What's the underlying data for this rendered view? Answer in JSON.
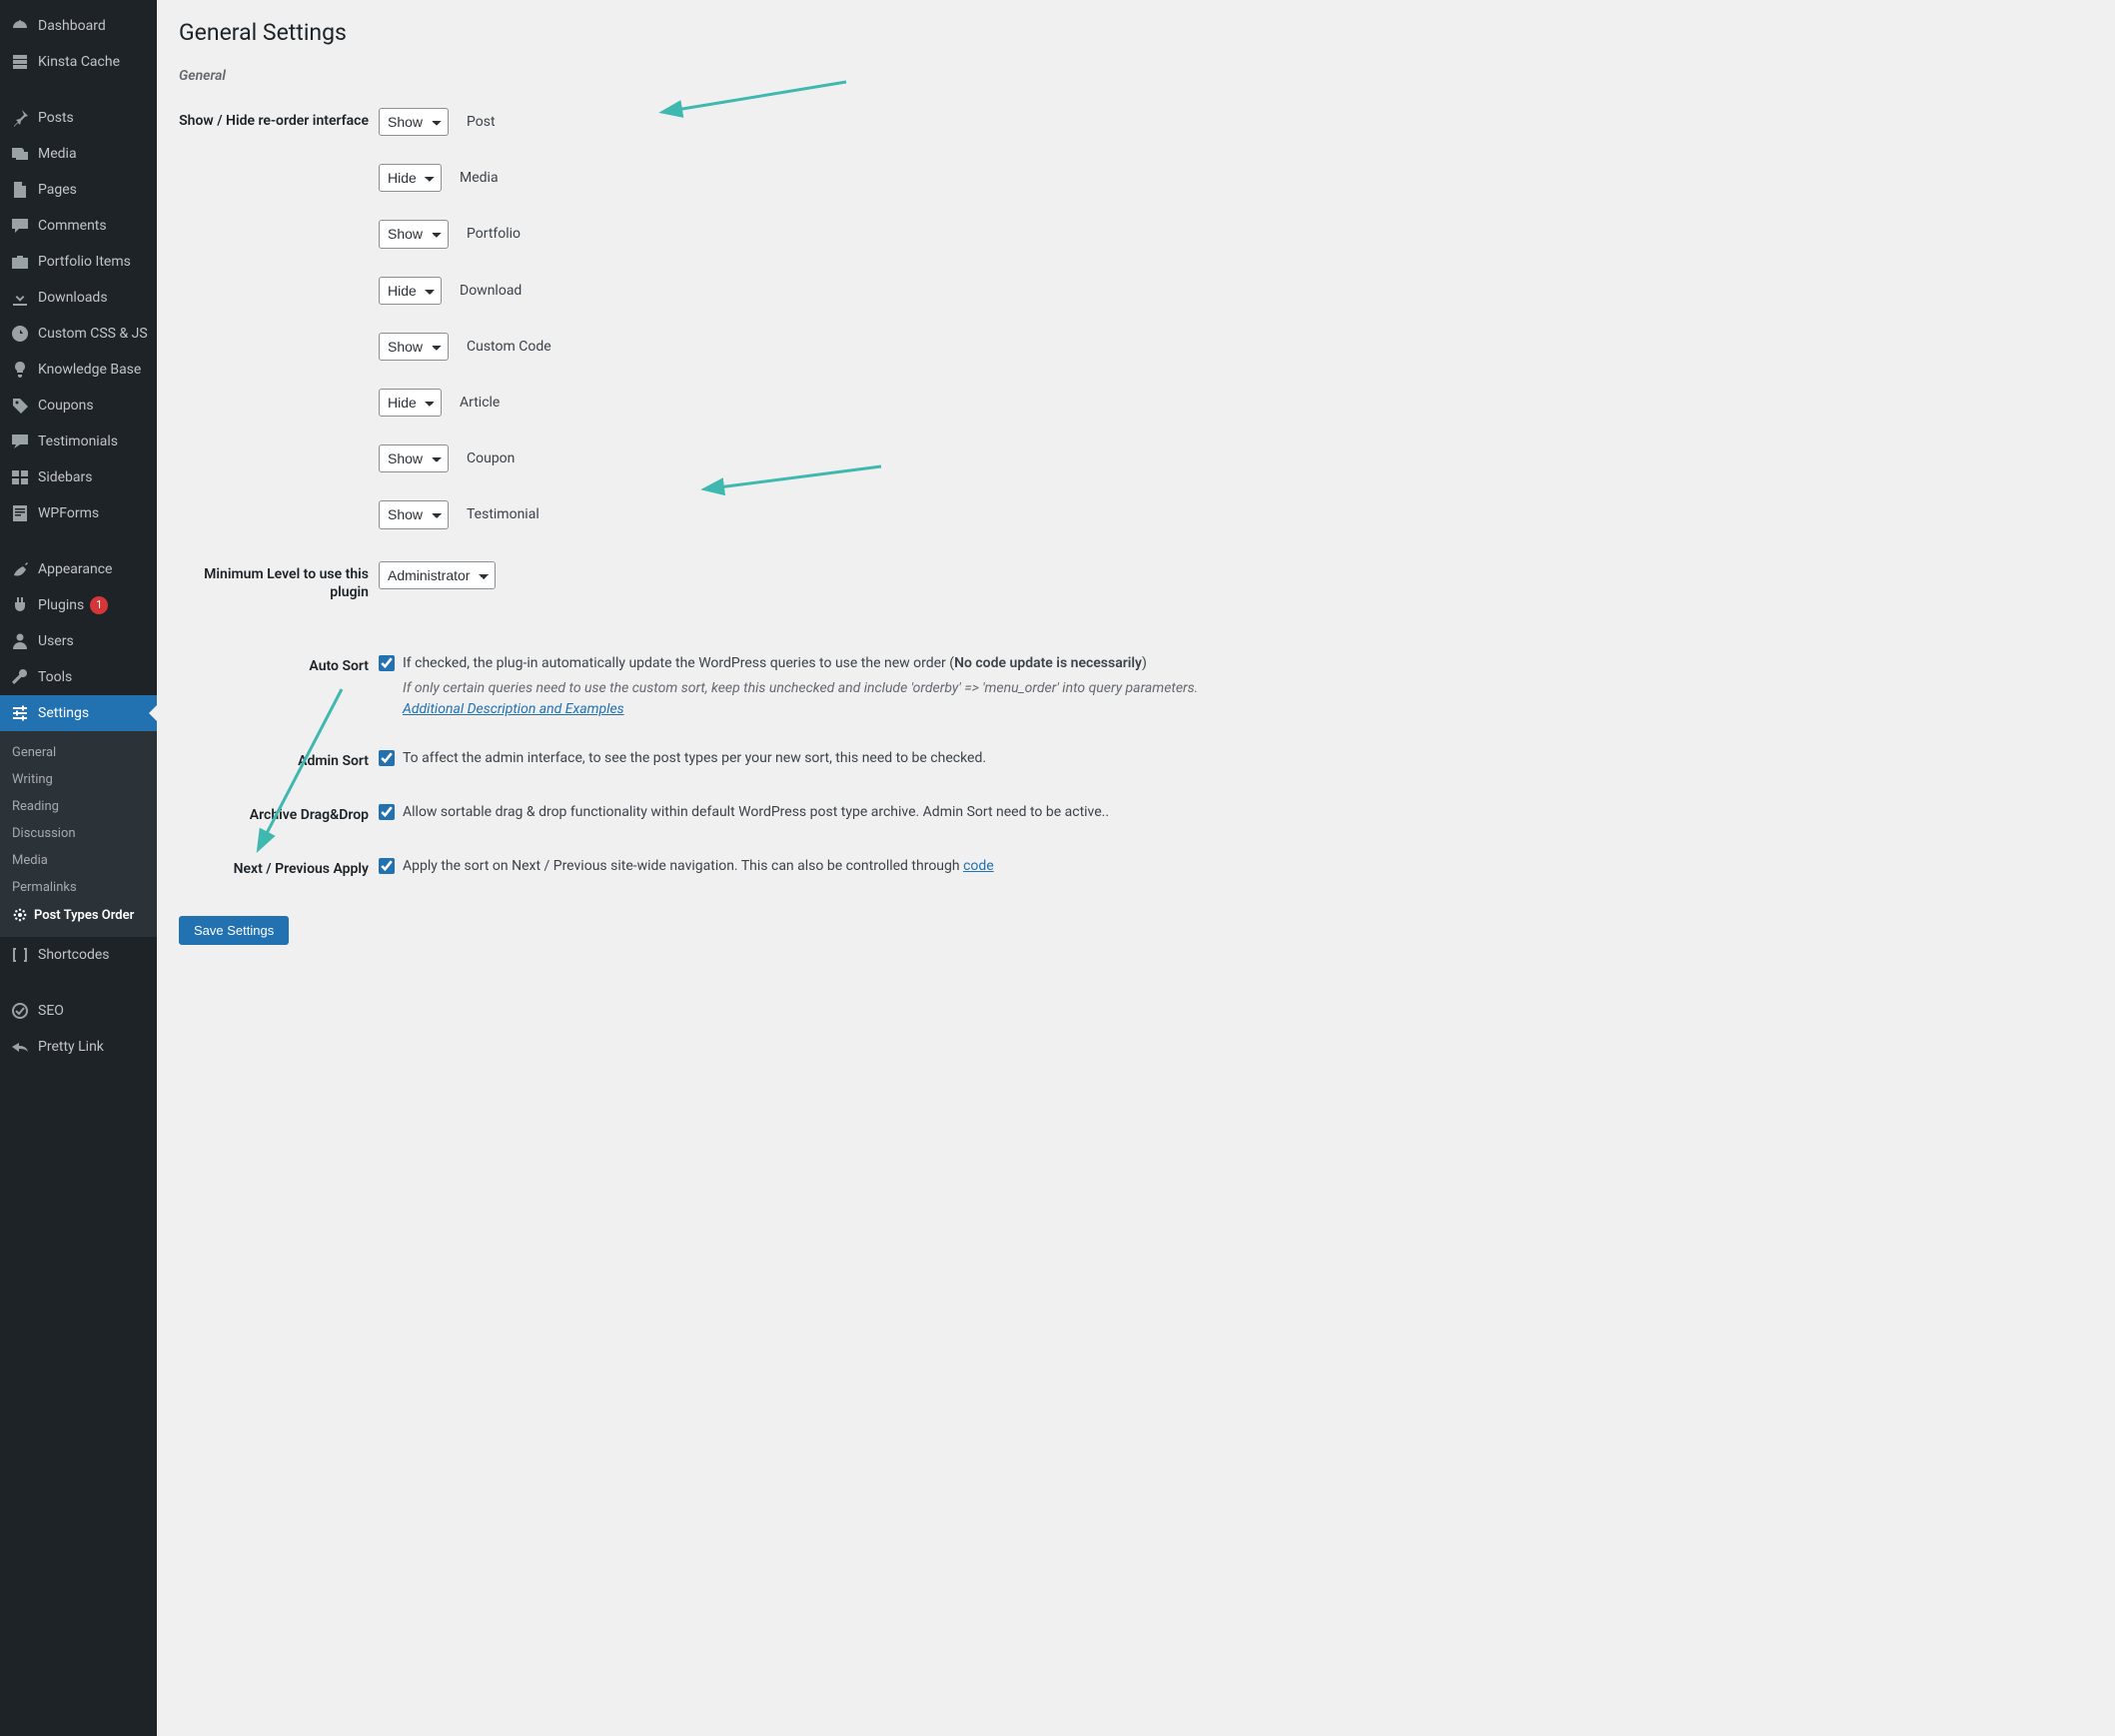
{
  "page": {
    "title": "General Settings",
    "section": "General",
    "save_label": "Save Settings"
  },
  "sidebar": {
    "items": [
      {
        "icon": "dashboard",
        "label": "Dashboard"
      },
      {
        "icon": "cache",
        "label": "Kinsta Cache"
      },
      {
        "sep": true
      },
      {
        "icon": "pin",
        "label": "Posts"
      },
      {
        "icon": "media",
        "label": "Media"
      },
      {
        "icon": "page",
        "label": "Pages"
      },
      {
        "icon": "comment",
        "label": "Comments"
      },
      {
        "icon": "portfolio",
        "label": "Portfolio Items"
      },
      {
        "icon": "download",
        "label": "Downloads"
      },
      {
        "icon": "code",
        "label": "Custom CSS & JS"
      },
      {
        "icon": "bulb",
        "label": "Knowledge Base"
      },
      {
        "icon": "tag",
        "label": "Coupons"
      },
      {
        "icon": "testimonial",
        "label": "Testimonials"
      },
      {
        "icon": "sidebars",
        "label": "Sidebars"
      },
      {
        "icon": "wpforms",
        "label": "WPForms"
      },
      {
        "sep": true
      },
      {
        "icon": "appearance",
        "label": "Appearance"
      },
      {
        "icon": "plugin",
        "label": "Plugins",
        "badge": "1"
      },
      {
        "icon": "users",
        "label": "Users"
      },
      {
        "icon": "tools",
        "label": "Tools"
      },
      {
        "icon": "settings",
        "label": "Settings",
        "current": true
      }
    ],
    "submenu": [
      {
        "label": "General"
      },
      {
        "label": "Writing"
      },
      {
        "label": "Reading"
      },
      {
        "label": "Discussion"
      },
      {
        "label": "Media"
      },
      {
        "label": "Permalinks"
      },
      {
        "label": "Post Types Order",
        "current": true,
        "icon": "pto"
      }
    ],
    "after": [
      {
        "icon": "shortcodes",
        "label": "Shortcodes"
      },
      {
        "sep": true
      },
      {
        "icon": "seo",
        "label": "SEO"
      },
      {
        "icon": "prettylink",
        "label": "Pretty Link"
      }
    ]
  },
  "settings": {
    "reorder_label": "Show / Hide re-order interface",
    "post_types": [
      {
        "value": "Show",
        "label": "Post"
      },
      {
        "value": "Hide",
        "label": "Media"
      },
      {
        "value": "Show",
        "label": "Portfolio"
      },
      {
        "value": "Hide",
        "label": "Download"
      },
      {
        "value": "Show",
        "label": "Custom Code"
      },
      {
        "value": "Hide",
        "label": "Article"
      },
      {
        "value": "Show",
        "label": "Coupon"
      },
      {
        "value": "Show",
        "label": "Testimonial"
      }
    ],
    "min_level_label": "Minimum Level to use this plugin",
    "min_level_value": "Administrator",
    "auto_sort": {
      "label": "Auto Sort",
      "checked": true,
      "desc_pre": "If checked, the plug-in automatically update the WordPress queries to use the new order (",
      "desc_bold": "No code update is necessarily",
      "desc_post": ")",
      "hint": "If only certain queries need to use the custom sort, keep this unchecked and include 'orderby' => 'menu_order' into query parameters. ",
      "hint_link": "Additional Description and Examples"
    },
    "admin_sort": {
      "label": "Admin Sort",
      "checked": true,
      "desc": "To affect the admin interface, to see the post types per your new sort, this need to be checked."
    },
    "archive_dnd": {
      "label": "Archive Drag&Drop",
      "checked": true,
      "desc": "Allow sortable drag & drop functionality within default WordPress post type archive. Admin Sort need to be active.."
    },
    "next_prev": {
      "label": "Next / Previous Apply",
      "checked": true,
      "desc_pre": "Apply the sort on Next / Previous site-wide navigation. This can also be controlled through ",
      "desc_link": "code"
    }
  }
}
